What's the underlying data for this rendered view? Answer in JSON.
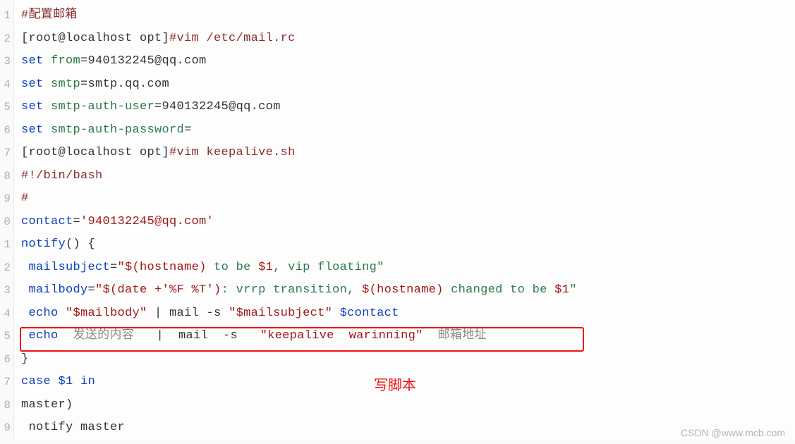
{
  "gutter": [
    "1",
    "2",
    "3",
    "4",
    "5",
    "6",
    "7",
    "8",
    "9",
    "0",
    "1",
    "2",
    "3",
    "4",
    "5",
    "6",
    "7",
    "8",
    "9"
  ],
  "lines": {
    "l1": {
      "a": "#配置邮箱"
    },
    "l2": {
      "a": "[root@localhost opt]",
      "b": "#vim /etc/mail.rc"
    },
    "l3": {
      "a": "set",
      "b": " from",
      "c": "=940132245@qq.com"
    },
    "l4": {
      "a": "set",
      "b": " smtp",
      "c": "=smtp.qq.com"
    },
    "l5": {
      "a": "set",
      "b": " smtp-auth-user",
      "c": "=940132245@qq.com"
    },
    "l6": {
      "a": "set",
      "b": " smtp-auth-password",
      "c": "="
    },
    "l7": {
      "a": "[root@localhost opt]",
      "b": "#vim keepalive.sh"
    },
    "l8": {
      "a": "#!/bin/bash"
    },
    "l9": {
      "a": "#"
    },
    "l10": {
      "a": "contact",
      "b": "=",
      "c": "'940132245@qq.com'"
    },
    "l11": {
      "a": "notify",
      "b": "() {"
    },
    "l12": {
      "a": " mailsubject",
      "b": "=",
      "c": "\"$(hostname)",
      "d": " to be ",
      "e": "$1",
      "f": ", vip floating\""
    },
    "l13": {
      "a": " mailbody",
      "b": "=",
      "c": "\"$(date +'%F %T')",
      "d": ": vrrp transition, ",
      "e": "$(hostname)",
      "f": " changed to be ",
      "g": "$1",
      "h": "\""
    },
    "l14": {
      "a": " echo ",
      "b": "\"$mailbody\"",
      "c": " | mail -s ",
      "d": "\"$mailsubject\"",
      "e": " $contact"
    },
    "l15": {
      "a": " echo",
      "b": "  发送的内容   ",
      "c": "|  mail  -s   ",
      "d": "\"keepalive  warinning\"",
      "e": "  邮箱地址"
    },
    "l16": {
      "a": "}"
    },
    "l17": {
      "a": "case",
      "b": " $1 ",
      "c": "in"
    },
    "l18": {
      "a": "master)"
    },
    "l19": {
      "a": " notify master"
    }
  },
  "annotation": "写脚本",
  "watermark": "CSDN @www.mcb.com"
}
